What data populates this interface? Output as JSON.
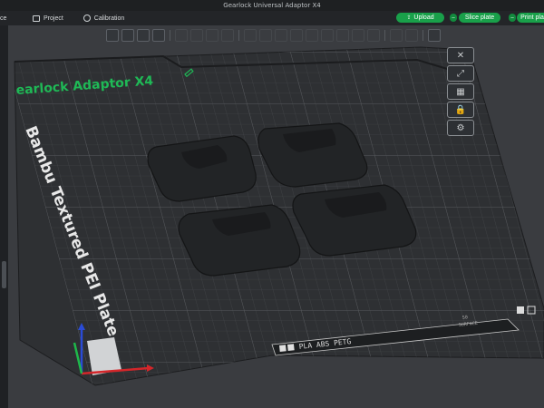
{
  "window": {
    "title": "Gearlock Universal Adaptor X4"
  },
  "menu": {
    "prepare": "ce",
    "project": "Project",
    "calibration": "Calibration"
  },
  "actions": {
    "upload": "Upload",
    "slice_plate": "Slice plate",
    "print_plate": "Print pla"
  },
  "plate": {
    "project_name": "earlock Adaptor X4",
    "plate_type": "Bambu Textured PEI Plate",
    "filament_label": "PLA ABS PETG",
    "footer_small_1": "50",
    "footer_small_2": "SURFACE"
  },
  "colors": {
    "accent": "#19a04a",
    "plate_grid": "#3b3d40",
    "bed_label": "#e8e8e8",
    "project_name": "#1fb956",
    "part": "#242628"
  }
}
